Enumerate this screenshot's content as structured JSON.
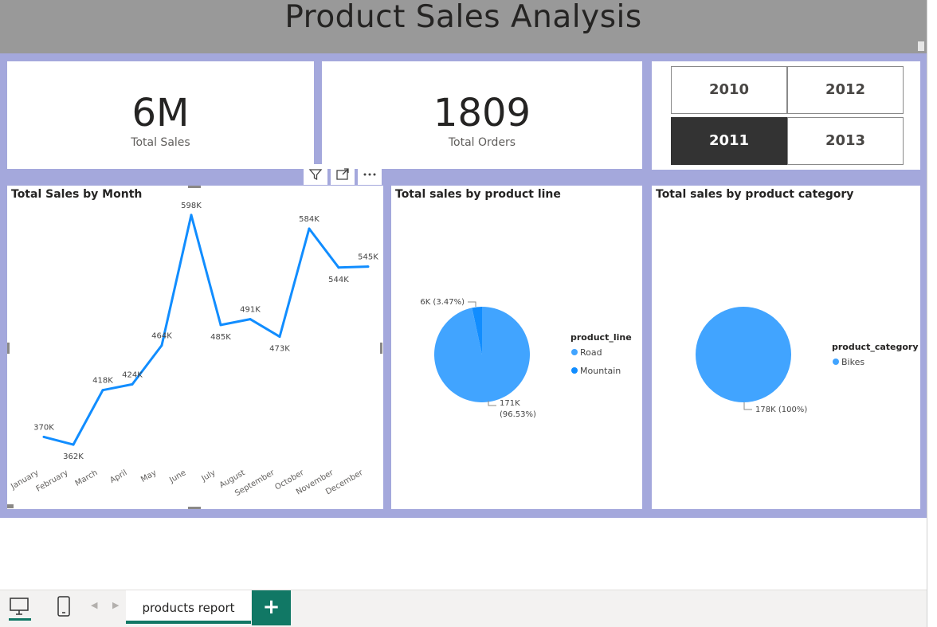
{
  "header": {
    "title": "Product Sales Analysis"
  },
  "kpis": {
    "total_sales": {
      "value": "6M",
      "label": "Total Sales"
    },
    "total_orders": {
      "value": "1809",
      "label": "Total Orders"
    }
  },
  "year_slicer": {
    "options": [
      "2010",
      "2012",
      "2011",
      "2013"
    ],
    "selected": "2011"
  },
  "visual_header_icons": [
    "filter-icon",
    "focus-mode-icon",
    "more-options-icon"
  ],
  "charts": {
    "line": {
      "title": "Total Sales by Month",
      "labels": [
        "370K",
        "362K",
        "418K",
        "424K",
        "464K",
        "598K",
        "485K",
        "491K",
        "473K",
        "584K",
        "544K",
        "545K"
      ]
    },
    "pie_product_line": {
      "title": "Total sales by product line",
      "legend_title": "product_line",
      "legend_items": [
        "Road",
        "Mountain"
      ],
      "label_small": "6K (3.47%)",
      "label_large_1": "171K",
      "label_large_2": "(96.53%)"
    },
    "pie_category": {
      "title": "Total sales by product category",
      "legend_title": "product_category",
      "legend_items": [
        "Bikes"
      ],
      "label": "178K (100%)"
    }
  },
  "chart_data": [
    {
      "type": "line",
      "title": "Total Sales by Month",
      "categories": [
        "January",
        "February",
        "March",
        "April",
        "May",
        "June",
        "July",
        "August",
        "September",
        "October",
        "November",
        "December"
      ],
      "series": [
        {
          "values": [
            370000,
            362000,
            418000,
            424000,
            464000,
            598000,
            485000,
            491000,
            473000,
            584000,
            544000,
            545000
          ]
        }
      ],
      "color": "#118dff",
      "xlabel": "",
      "ylabel": "",
      "grid": false
    },
    {
      "type": "pie",
      "title": "Total sales by product line",
      "categories": [
        "Road",
        "Mountain"
      ],
      "values": [
        171000,
        6000
      ],
      "percentages": [
        96.53,
        3.47
      ],
      "colors": [
        "#41a4ff",
        "#118dff"
      ],
      "legend": "right"
    },
    {
      "type": "pie",
      "title": "Total sales by product category",
      "categories": [
        "Bikes"
      ],
      "values": [
        178000
      ],
      "percentages": [
        100
      ],
      "colors": [
        "#41a4ff"
      ],
      "legend": "right"
    }
  ],
  "tabs": {
    "active": "products report",
    "add_label": "+"
  },
  "colors": {
    "canvas": "#a4a8dc",
    "header": "#999999",
    "accent": "#117865",
    "line": "#118dff",
    "pie_light": "#41a4ff",
    "pie_dark": "#118dff",
    "selected_slicer": "#333333"
  }
}
